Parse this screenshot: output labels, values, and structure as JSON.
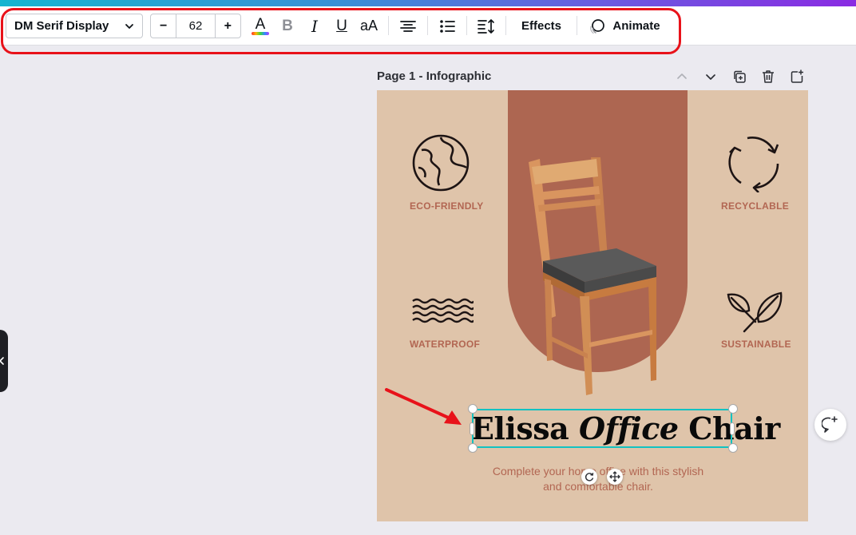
{
  "toolbar": {
    "font_family": "DM Serif Display",
    "font_size": "62",
    "decrease_label": "−",
    "increase_label": "+",
    "effects_label": "Effects",
    "animate_label": "Animate",
    "underline_glyph": "U",
    "case_glyph": "aA",
    "bold_glyph": "B",
    "italic_glyph": "I",
    "text_color_glyph": "A"
  },
  "page": {
    "label": "Page 1 - Infographic"
  },
  "design": {
    "features": [
      {
        "label": "ECO-FRIENDLY",
        "icon": "globe-icon"
      },
      {
        "label": "RECYCLABLE",
        "icon": "recycle-icon"
      },
      {
        "label": "WATERPROOF",
        "icon": "waves-icon"
      },
      {
        "label": "SUSTAINABLE",
        "icon": "leaves-icon"
      }
    ],
    "title_part1": "Elissa ",
    "title_part2": "Office",
    "title_part3": " Chair",
    "subtitle_line1": "Complete your home office with this stylish",
    "subtitle_line2": "and comfortable chair."
  },
  "colors": {
    "canvas_bg": "#dfc4aa",
    "arch": "#ad6651",
    "accent_text": "#b26652",
    "selection": "#13c2c2",
    "annotation": "#e8121a"
  }
}
